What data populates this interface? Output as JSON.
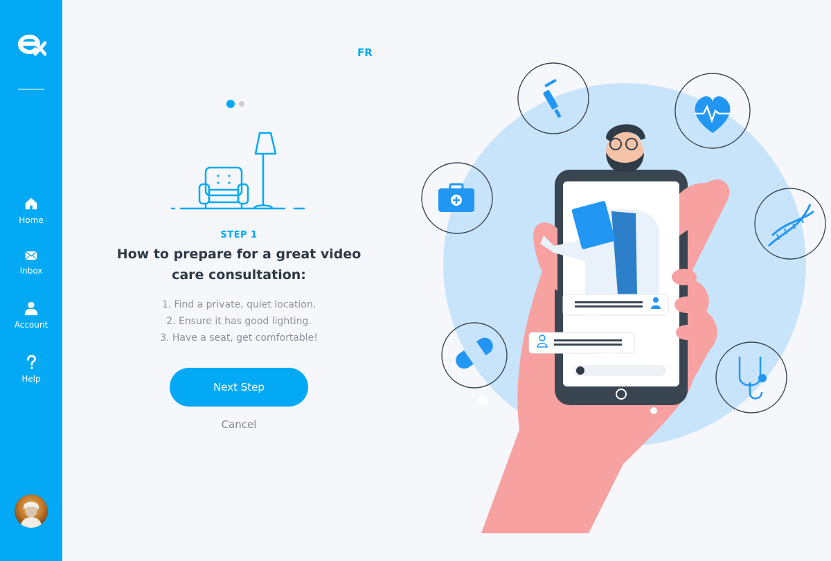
{
  "sidebar": {
    "nav": [
      {
        "label": "Home",
        "icon": "home-icon"
      },
      {
        "label": "Inbox",
        "icon": "mail-icon"
      },
      {
        "label": "Account",
        "icon": "person-icon"
      },
      {
        "label": "Help",
        "icon": "help-icon"
      }
    ]
  },
  "header": {
    "language_toggle": "FR"
  },
  "carousel": {
    "current": 1,
    "total": 2
  },
  "onboarding": {
    "step_label": "STEP 1",
    "heading": "How to prepare for a great video care consultation:",
    "steps": [
      "1. Find a private, quiet location.",
      "2. Ensure it has good lighting.",
      "3. Have a seat, get comfortable!"
    ],
    "next_label": "Next Step",
    "cancel_label": "Cancel"
  },
  "colors": {
    "accent": "#03a9f4",
    "background": "#f6f7fb",
    "hand": "#f7a1a1",
    "circle": "#c8e4fb"
  }
}
